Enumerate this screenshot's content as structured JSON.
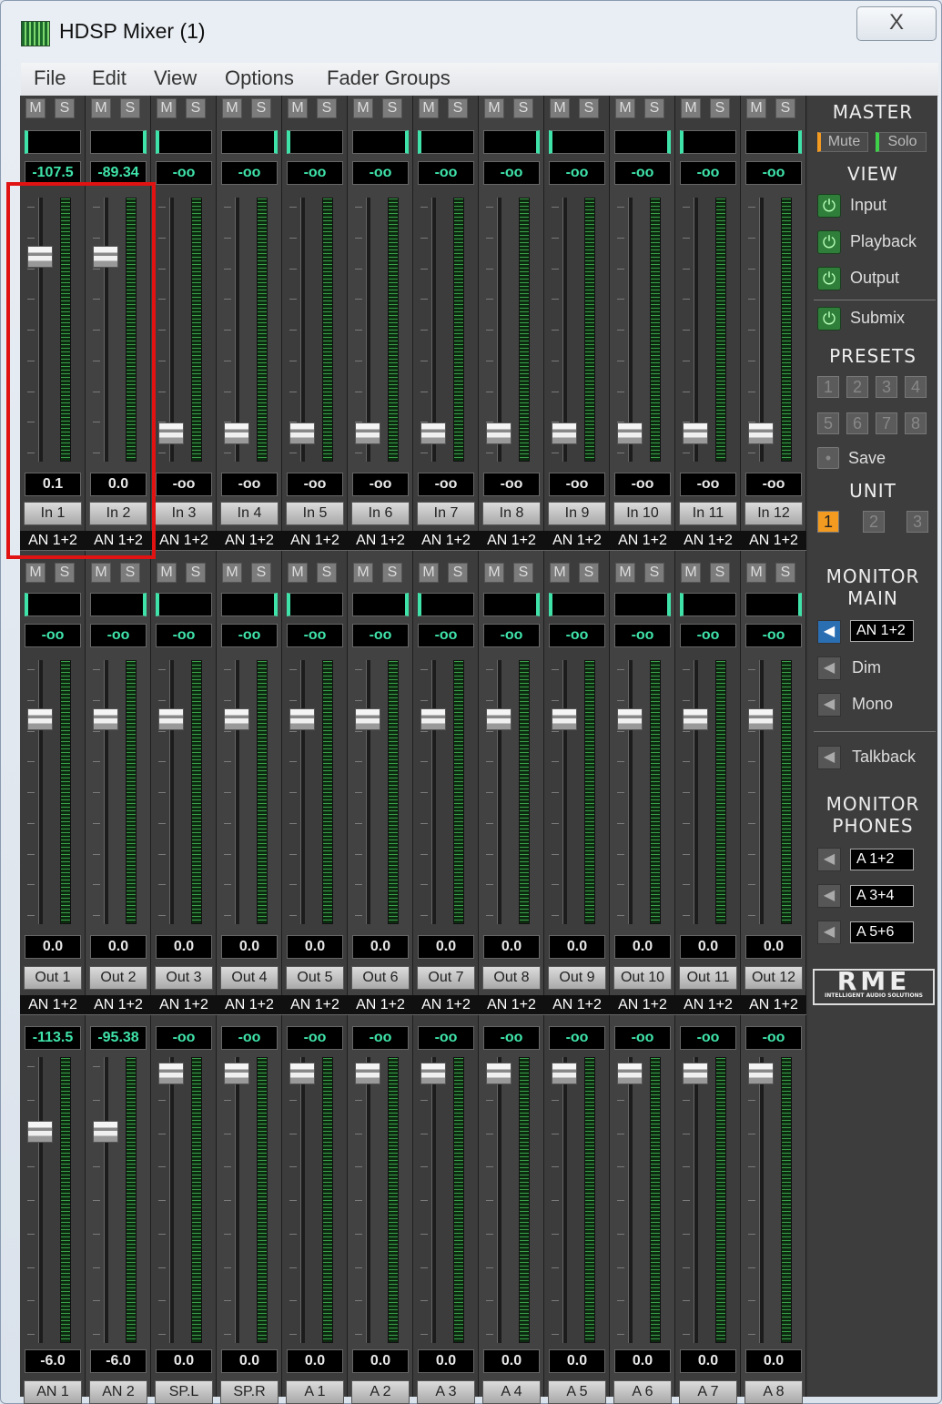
{
  "window": {
    "title": "HDSP Mixer (1)",
    "close_label": "X"
  },
  "menu": [
    "File",
    "Edit",
    "View",
    "Options",
    "Fader Groups"
  ],
  "colors": {
    "level_text": "#3fe3a9",
    "highlight_box": "#e01212",
    "unit_active": "#f39a20"
  },
  "mute_label": "M",
  "solo_label": "S",
  "input_row": {
    "levels": [
      "-107.5",
      "-89.34",
      "-oo",
      "-oo",
      "-oo",
      "-oo",
      "-oo",
      "-oo",
      "-oo",
      "-oo",
      "-oo",
      "-oo"
    ],
    "gains": [
      "0.1",
      "0.0",
      "-oo",
      "-oo",
      "-oo",
      "-oo",
      "-oo",
      "-oo",
      "-oo",
      "-oo",
      "-oo",
      "-oo"
    ],
    "names": [
      "In 1",
      "In 2",
      "In 3",
      "In 4",
      "In 5",
      "In 6",
      "In 7",
      "In 8",
      "In 9",
      "In 10",
      "In 11",
      "In 12"
    ],
    "routes": [
      "AN 1+2",
      "AN 1+2",
      "AN 1+2",
      "AN 1+2",
      "AN 1+2",
      "AN 1+2",
      "AN 1+2",
      "AN 1+2",
      "AN 1+2",
      "AN 1+2",
      "AN 1+2",
      "AN 1+2"
    ]
  },
  "playback_row": {
    "levels": [
      "-oo",
      "-oo",
      "-oo",
      "-oo",
      "-oo",
      "-oo",
      "-oo",
      "-oo",
      "-oo",
      "-oo",
      "-oo",
      "-oo"
    ],
    "gains": [
      "0.0",
      "0.0",
      "0.0",
      "0.0",
      "0.0",
      "0.0",
      "0.0",
      "0.0",
      "0.0",
      "0.0",
      "0.0",
      "0.0"
    ],
    "names": [
      "Out 1",
      "Out 2",
      "Out 3",
      "Out 4",
      "Out 5",
      "Out 6",
      "Out 7",
      "Out 8",
      "Out 9",
      "Out 10",
      "Out 11",
      "Out 12"
    ],
    "routes": [
      "AN 1+2",
      "AN 1+2",
      "AN 1+2",
      "AN 1+2",
      "AN 1+2",
      "AN 1+2",
      "AN 1+2",
      "AN 1+2",
      "AN 1+2",
      "AN 1+2",
      "AN 1+2",
      "AN 1+2"
    ]
  },
  "output_row": {
    "levels": [
      "-113.5",
      "-95.38",
      "-oo",
      "-oo",
      "-oo",
      "-oo",
      "-oo",
      "-oo",
      "-oo",
      "-oo",
      "-oo",
      "-oo"
    ],
    "gains": [
      "-6.0",
      "-6.0",
      "0.0",
      "0.0",
      "0.0",
      "0.0",
      "0.0",
      "0.0",
      "0.0",
      "0.0",
      "0.0",
      "0.0"
    ],
    "names": [
      "AN 1",
      "AN 2",
      "SP.L",
      "SP.R",
      "A 1",
      "A 2",
      "A 3",
      "A 4",
      "A 5",
      "A 6",
      "A 7",
      "A 8"
    ]
  },
  "side": {
    "master_heading": "MASTER",
    "mute": "Mute",
    "solo": "Solo",
    "view_heading": "VIEW",
    "view_items": [
      "Input",
      "Playback",
      "Output",
      "Submix"
    ],
    "presets_heading": "PRESETS",
    "presets": [
      "1",
      "2",
      "3",
      "4",
      "5",
      "6",
      "7",
      "8"
    ],
    "save": "Save",
    "unit_heading": "UNIT",
    "units": [
      "1",
      "2",
      "3"
    ],
    "monitor_main_heading_1": "MONITOR",
    "monitor_main_heading_2": "MAIN",
    "main_route": "AN 1+2",
    "dim": "Dim",
    "mono": "Mono",
    "talkback": "Talkback",
    "monitor_phones_heading_1": "MONITOR",
    "monitor_phones_heading_2": "PHONES",
    "phones_routes": [
      "A 1+2",
      "A 3+4",
      "A 5+6"
    ],
    "logo": "RME",
    "logo_sub": "INTELLIGENT AUDIO SOLUTIONS"
  }
}
